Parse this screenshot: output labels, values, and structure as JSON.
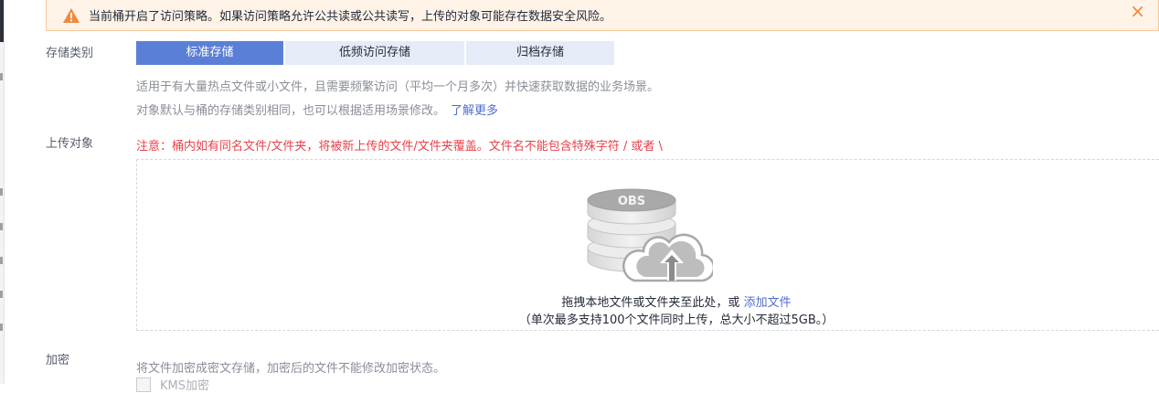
{
  "alert": {
    "text": "当前桶开启了访问策略。如果访问策略允许公共读或公共读写，上传的对象可能存在数据安全风险。",
    "close_icon": "×",
    "warning_color": "#f08a3e"
  },
  "storage_class": {
    "label": "存储类别",
    "tabs": [
      {
        "label": "标准存储",
        "active": true
      },
      {
        "label": "低频访问存储",
        "active": false
      },
      {
        "label": "归档存储",
        "active": false
      }
    ],
    "desc1": "适用于有大量热点文件或小文件，且需要频繁访问（平均一个月多次）并快速获取数据的业务场景。",
    "desc2": "对象默认与桶的存储类别相同，也可以根据适用场景修改。",
    "learn_more": "了解更多"
  },
  "upload": {
    "label": "上传对象",
    "warning": "注意：桶内如有同名文件/文件夹，将被新上传的文件/文件夹覆盖。文件名不能包含特殊字符 / 或者 \\",
    "obs_text": "OBS",
    "drop_text": "拖拽本地文件或文件夹至此处，或",
    "add_file": "添加文件",
    "limit_text": "（单次最多支持100个文件同时上传，总大小不超过5GB。）"
  },
  "encryption": {
    "label": "加密",
    "desc": "将文件加密成密文存储，加密后的文件不能修改加密状态。",
    "kms_label": "KMS加密"
  },
  "colors": {
    "accent": "#5a7fd6",
    "link": "#526ecc",
    "danger": "#e6434b"
  }
}
